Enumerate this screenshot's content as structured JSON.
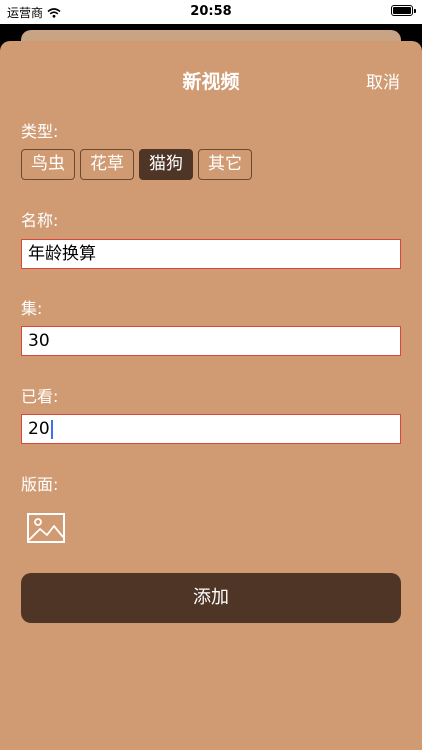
{
  "status_bar": {
    "carrier": "运营商",
    "time": "20:58"
  },
  "header": {
    "title": "新视频",
    "cancel_label": "取消"
  },
  "form": {
    "type_label": "类型:",
    "types": [
      {
        "label": "鸟虫",
        "selected": false
      },
      {
        "label": "花草",
        "selected": false
      },
      {
        "label": "猫狗",
        "selected": true
      },
      {
        "label": "其它",
        "selected": false
      }
    ],
    "name_label": "名称:",
    "name_value": "年龄换算",
    "episodes_label": "集:",
    "episodes_value": "30",
    "watched_label": "已看:",
    "watched_value": "20",
    "cover_label": "版面:",
    "cover_icon": "image-icon",
    "add_label": "添加"
  },
  "colors": {
    "sheet": "#d09b72",
    "accent": "#4f3526",
    "field_border": "#d9463b"
  }
}
